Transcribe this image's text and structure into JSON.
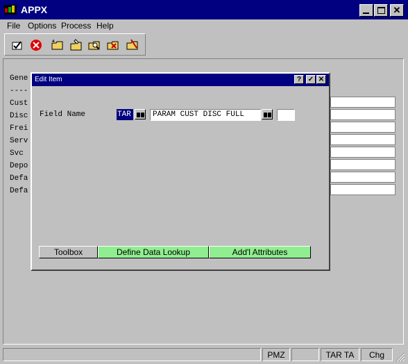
{
  "window": {
    "title": "APPX"
  },
  "menu": {
    "items": [
      "File",
      "Options",
      "Process",
      "Help"
    ]
  },
  "toolbar": {
    "icons": [
      "check-icon",
      "cancel-icon",
      "folder-new-icon",
      "folder-edit-icon",
      "folder-search-icon",
      "folder-delete-icon",
      "folder-check-icon"
    ]
  },
  "background": {
    "labels": [
      "Gene",
      "----",
      "Cust",
      "Disc",
      "Frei",
      "Serv",
      "Svc",
      "Depo",
      "Defa",
      "Defa"
    ]
  },
  "dialog": {
    "title": "Edit Item",
    "field_label": "Field Name",
    "field_code": "TAR",
    "field_value": "PARAM CUST DISC FULL",
    "extra_value": "",
    "buttons": {
      "toolbox": "Toolbox",
      "define_lookup": "Define Data Lookup",
      "addl_attributes": "Add'l Attributes"
    }
  },
  "status": {
    "panels": [
      "",
      "PMZ",
      "",
      "TAR TA",
      "Chg"
    ]
  },
  "colors": {
    "titlebar": "#000080",
    "green_button": "#90ee90",
    "face": "#c0c0c0"
  }
}
